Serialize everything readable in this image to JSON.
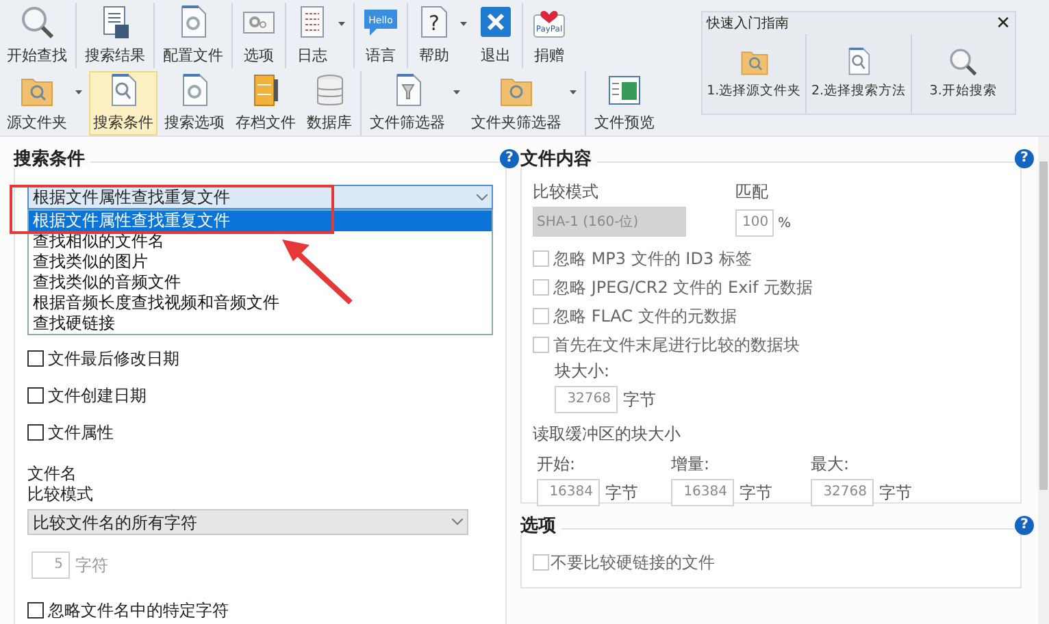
{
  "toolbar": {
    "top_row": [
      {
        "label": "开始查找",
        "kind": "magnifier",
        "dropdown": false,
        "selected": false,
        "group_end": true
      },
      {
        "label": "搜索结果",
        "kind": "doc-disk",
        "dropdown": false,
        "selected": false,
        "group_end": true
      },
      {
        "label": "配置文件",
        "kind": "doc-gear",
        "dropdown": false,
        "selected": false,
        "group_end": true
      },
      {
        "label": "选项",
        "kind": "window-gear",
        "dropdown": false,
        "selected": false,
        "group_end": true
      },
      {
        "label": "日志",
        "kind": "doc-grid",
        "dropdown": true,
        "selected": false,
        "group_end": true
      },
      {
        "label": "语言",
        "kind": "bubble",
        "icon_text": "Hello",
        "dropdown": false,
        "selected": false,
        "group_end": true
      },
      {
        "label": "帮助",
        "kind": "question",
        "icon_text": "?",
        "dropdown": true,
        "selected": false,
        "group_end": false
      },
      {
        "label": "退出",
        "kind": "close-box",
        "dropdown": false,
        "selected": false,
        "group_end": true
      },
      {
        "label": "捐赠",
        "kind": "heart-card",
        "icon_text": "PayPal",
        "dropdown": false,
        "selected": false,
        "group_end": false
      }
    ],
    "bottom_row": [
      {
        "label": "源文件夹",
        "kind": "folder-search",
        "dropdown": true,
        "selected": false,
        "group_end": false
      },
      {
        "label": "搜索条件",
        "kind": "doc-search",
        "dropdown": false,
        "selected": true,
        "group_end": false
      },
      {
        "label": "搜索选项",
        "kind": "doc-gear",
        "dropdown": false,
        "selected": false,
        "group_end": false
      },
      {
        "label": "存档文件",
        "kind": "archive",
        "dropdown": false,
        "selected": false,
        "group_end": false
      },
      {
        "label": "数据库",
        "kind": "database",
        "dropdown": false,
        "selected": false,
        "group_end": true
      },
      {
        "label": "文件筛选器",
        "kind": "doc-filter",
        "dropdown": true,
        "selected": false,
        "group_end": false
      },
      {
        "label": "文件夹筛选器",
        "kind": "folder-filter",
        "dropdown": true,
        "selected": false,
        "group_end": true
      },
      {
        "label": "文件预览",
        "kind": "preview",
        "dropdown": false,
        "selected": false,
        "group_end": false
      }
    ]
  },
  "quick_guide": {
    "title": "快速入门指南",
    "close": "✕",
    "steps": [
      {
        "label": "1.选择源文件夹",
        "kind": "folder-search"
      },
      {
        "label": "2.选择搜索方法",
        "kind": "doc-search"
      },
      {
        "label": "3.开始搜索",
        "kind": "magnifier"
      }
    ]
  },
  "search_criteria": {
    "title": "搜索条件",
    "help": "?",
    "method": {
      "value": "根据文件属性查找重复文件",
      "expanded": true,
      "options": [
        {
          "label": "根据文件属性查找重复文件",
          "selected": true
        },
        {
          "label": "查找相似的文件名",
          "selected": false
        },
        {
          "label": "查找类似的图片",
          "selected": false
        },
        {
          "label": "查找类似的音频文件",
          "selected": false
        },
        {
          "label": "根据音频长度查找视频和音频文件",
          "selected": false
        },
        {
          "label": "查找硬链接",
          "selected": false
        }
      ]
    },
    "checks": [
      {
        "label": "文件最后修改日期",
        "checked": false
      },
      {
        "label": "文件创建日期",
        "checked": false
      },
      {
        "label": "文件属性",
        "checked": false
      }
    ],
    "filename_label": "文件名",
    "compare_label": "比较模式",
    "compare_value": "比较文件名的所有字符",
    "chars": {
      "value": "5",
      "unit": "字符",
      "disabled": true
    },
    "ignore_chars": {
      "label": "忽略文件名中的特定字符",
      "checked": false
    }
  },
  "file_content": {
    "title": "文件内容",
    "help": "?",
    "compare_label": "比较模式",
    "compare_value": "SHA-1 (160-位)",
    "compare_disabled": true,
    "match_label": "匹配",
    "match_value": "100",
    "match_unit": "%",
    "checks": [
      {
        "label": "忽略 MP3 文件的 ID3 标签",
        "checked": false,
        "disabled": true
      },
      {
        "label": "忽略 JPEG/CR2 文件的 Exif 元数据",
        "checked": false,
        "disabled": true
      },
      {
        "label": "忽略 FLAC 文件的元数据",
        "checked": false,
        "disabled": true
      },
      {
        "label": "首先在文件末尾进行比较的数据块",
        "checked": false,
        "disabled": true
      }
    ],
    "block_label": "块大小:",
    "block_value": "32768",
    "block_unit": "字节",
    "buffer_label": "读取缓冲区的块大小",
    "buffer": [
      {
        "label": "开始:",
        "value": "16384",
        "unit": "字节"
      },
      {
        "label": "增量:",
        "value": "16384",
        "unit": "字节"
      },
      {
        "label": "最大:",
        "value": "32768",
        "unit": "字节"
      }
    ]
  },
  "options": {
    "title": "选项",
    "help": "?",
    "checks": [
      {
        "label": "不要比较硬链接的文件",
        "checked": false,
        "disabled": true
      }
    ]
  }
}
